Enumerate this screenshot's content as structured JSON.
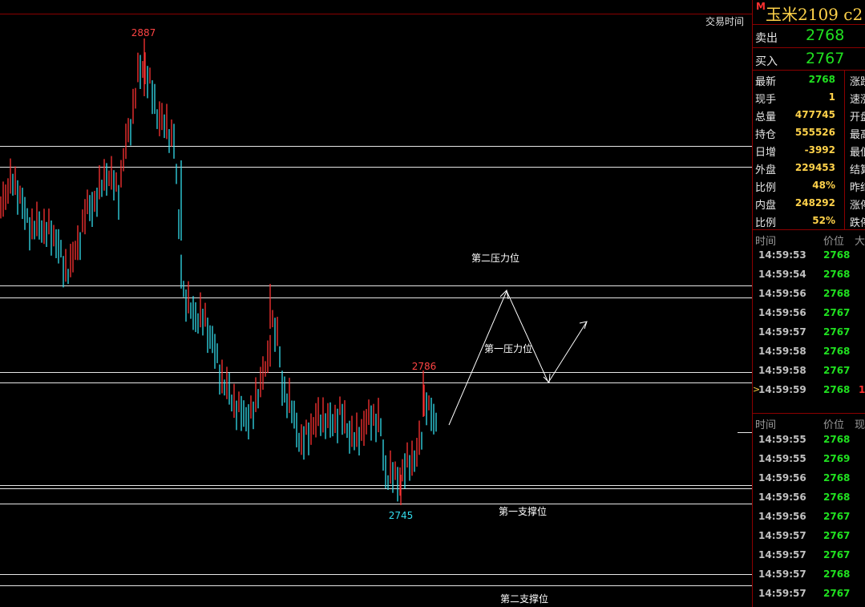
{
  "colors": {
    "up": "#ff3333",
    "down": "#33ddee",
    "green": "#20e020",
    "yellow": "#ffd24a",
    "divider": "#8b0000"
  },
  "chart": {
    "corner_label": "交易时间",
    "labels": {
      "high": "2887",
      "peak2": "2786",
      "low": "2745"
    },
    "annotations": {
      "resist2": "第二压力位",
      "resist1": "第一压力位",
      "support1": "第一支撑位",
      "support2": "第二支撑位"
    }
  },
  "panel": {
    "marker": "M",
    "symbol": "玉米2109  c2",
    "sell": {
      "label": "卖出",
      "value": "2768"
    },
    "buy": {
      "label": "买入",
      "value": "2767"
    },
    "quotes": [
      {
        "label": "最新",
        "value": "2768",
        "color": "green",
        "right": "涨跌"
      },
      {
        "label": "现手",
        "value": "1",
        "color": "yellow",
        "right": "速涨"
      },
      {
        "label": "总量",
        "value": "477745",
        "color": "yellow",
        "right": "开盘"
      },
      {
        "label": "持仓",
        "value": "555526",
        "color": "yellow",
        "right": "最高"
      },
      {
        "label": "日增",
        "value": "-3992",
        "color": "yellow",
        "right": "最低"
      },
      {
        "label": "外盘",
        "value": "229453",
        "color": "yellow",
        "right": "结算"
      },
      {
        "label": "比例",
        "value": "48%",
        "color": "yellow",
        "right": "昨结"
      },
      {
        "label": "内盘",
        "value": "248292",
        "color": "yellow",
        "right": "涨停"
      },
      {
        "label": "比例",
        "value": "52%",
        "color": "yellow",
        "right": "跌停"
      }
    ],
    "ticks1": {
      "headers": [
        "时间",
        "价位",
        "大"
      ],
      "rows": [
        {
          "time": "14:59:53",
          "price": "2768",
          "extra": ""
        },
        {
          "time": "14:59:54",
          "price": "2768",
          "extra": ""
        },
        {
          "time": "14:59:56",
          "price": "2768",
          "extra": ""
        },
        {
          "time": "14:59:56",
          "price": "2767",
          "extra": ""
        },
        {
          "time": "14:59:57",
          "price": "2767",
          "extra": ""
        },
        {
          "time": "14:59:58",
          "price": "2768",
          "extra": ""
        },
        {
          "time": "14:59:58",
          "price": "2767",
          "extra": ""
        },
        {
          "time": "14:59:59",
          "price": "2768",
          "extra": "1"
        }
      ]
    },
    "ticks2": {
      "headers": [
        "时间",
        "价位",
        "现"
      ],
      "rows": [
        {
          "time": "14:59:55",
          "price": "2768"
        },
        {
          "time": "14:59:55",
          "price": "2769"
        },
        {
          "time": "14:59:56",
          "price": "2768"
        },
        {
          "time": "14:59:56",
          "price": "2768"
        },
        {
          "time": "14:59:56",
          "price": "2767"
        },
        {
          "time": "14:59:57",
          "price": "2767"
        },
        {
          "time": "14:59:57",
          "price": "2767"
        },
        {
          "time": "14:59:57",
          "price": "2768"
        },
        {
          "time": "14:59:57",
          "price": "2767"
        }
      ]
    }
  }
}
